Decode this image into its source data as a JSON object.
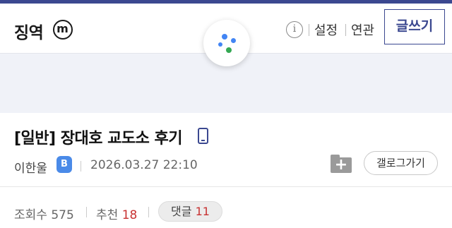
{
  "header": {
    "gallery_name": "징역",
    "minor_badge": "m",
    "info_icon": "i",
    "settings_label": "설정",
    "related_label": "연관",
    "write_label": "글쓰기"
  },
  "post": {
    "title": "[일반] 장대호 교도소 후기",
    "author": "이한울",
    "grade_badge": "B",
    "date": "2026.03.27 22:10",
    "scrap_label": "갤로그가기"
  },
  "stats": {
    "views_label": "조회수",
    "views": "575",
    "recommend_label": "추천",
    "recommend": "18",
    "comments_label": "댓글",
    "comments": "11"
  },
  "colors": {
    "brand": "#3b4890",
    "accent_red": "#c83232",
    "grade_blue": "#4a8ae8",
    "loader_blue": "#4285f4",
    "loader_green": "#34a853"
  }
}
